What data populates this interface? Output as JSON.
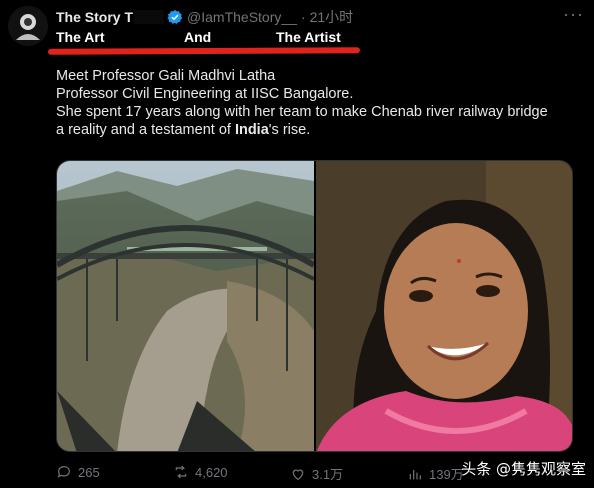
{
  "tweet": {
    "author": {
      "display_name": "The Story T",
      "handle": "@IamTheStory__",
      "separator": "·",
      "time": "21小时"
    },
    "overlay": {
      "part1": "The Art",
      "part2": "And",
      "part3": "The Artist",
      "underline_color": "#e0241b"
    },
    "text": {
      "line1": "Meet Professor Gali Madhvi Latha",
      "line2": "Professor Civil Engineering at IISC Bangalore.",
      "line3": "She spent 17 years along with her team to make Chenab river railway bridge",
      "line4_pre": "a reality and a testament of ",
      "line4_bold": "India",
      "line4_post": "'s rise."
    },
    "actions": {
      "reply": "265",
      "retweet": "4,620",
      "like": "3.1万",
      "views": "139万"
    },
    "more": "···"
  },
  "watermark": "头条 @隽隽观察室",
  "colors": {
    "background": "#000000",
    "text": "#e7e9ea",
    "muted": "#71767b",
    "verified": "#1d9bf0"
  }
}
